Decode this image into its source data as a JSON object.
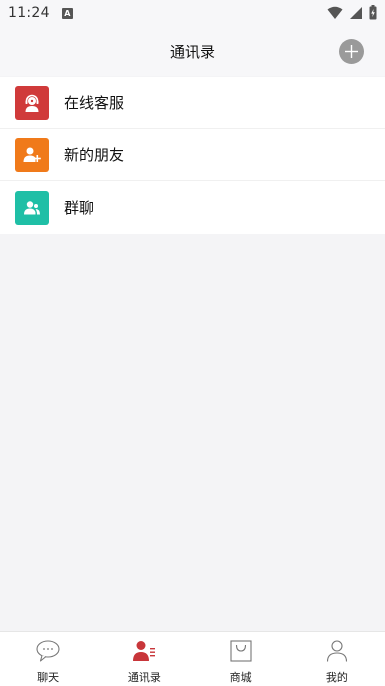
{
  "status_bar": {
    "time": "11:24",
    "badge_letter": "A"
  },
  "header": {
    "title": "通讯录"
  },
  "colors": {
    "customer_service": "#d03a3a",
    "new_friends": "#f07a1a",
    "group_chat": "#1fbfa6",
    "active_tab": "#c8363a"
  },
  "contacts": {
    "items": [
      {
        "label": "在线客服",
        "icon": "customer-service-icon"
      },
      {
        "label": "新的朋友",
        "icon": "add-friend-icon"
      },
      {
        "label": "群聊",
        "icon": "group-icon"
      }
    ]
  },
  "bottom_nav": {
    "items": [
      {
        "label": "聊天",
        "icon": "chat-bubble-icon",
        "active": false
      },
      {
        "label": "通讯录",
        "icon": "contacts-icon",
        "active": true
      },
      {
        "label": "商城",
        "icon": "shopping-bag-icon",
        "active": false
      },
      {
        "label": "我的",
        "icon": "profile-icon",
        "active": false
      }
    ]
  }
}
